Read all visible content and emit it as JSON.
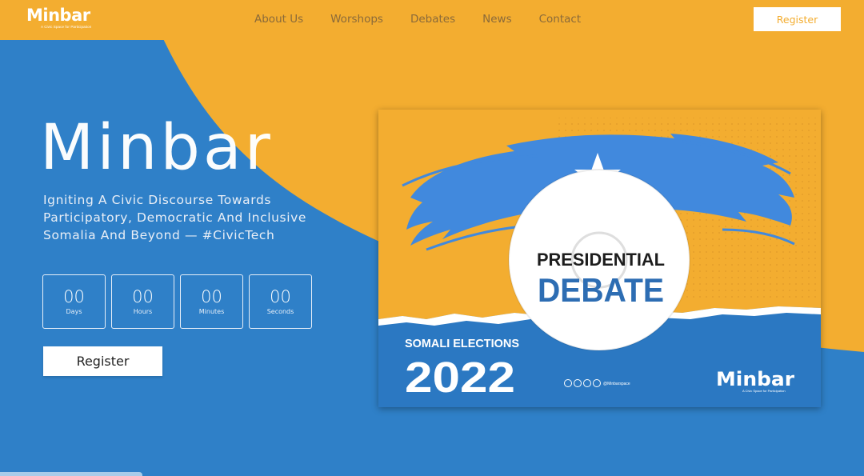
{
  "brand": {
    "name": "Minbar",
    "tagline": "A Civic Space for Participation"
  },
  "nav": {
    "links": [
      "About Us",
      "Worshops",
      "Debates",
      "News",
      "Contact"
    ],
    "register_label": "Register"
  },
  "hero": {
    "title": "Minbar",
    "subtitle": "Igniting A Civic Discourse Towards Participatory, Democratic And Inclusive Somalia And Beyond — #CivicTech",
    "register_label": "Register",
    "countdown": [
      {
        "value": "00",
        "label": "Days"
      },
      {
        "value": "00",
        "label": "Hours"
      },
      {
        "value": "00",
        "label": "Minutes"
      },
      {
        "value": "00",
        "label": "Seconds"
      }
    ]
  },
  "poster": {
    "line1": "PRESIDENTIAL",
    "line2": "DEBATE",
    "elections_label": "SOMALI ELECTIONS",
    "year": "2022",
    "social_handle": "@Minbarspace",
    "logo_text": "Minbar",
    "logo_tagline": "A Civic Space for Participation"
  },
  "colors": {
    "orange": "#f3ad30",
    "blue": "#2f80c8",
    "flag_blue": "#4189dd",
    "poster_blue": "#2b78c2",
    "debate_blue": "#2d6db3"
  }
}
